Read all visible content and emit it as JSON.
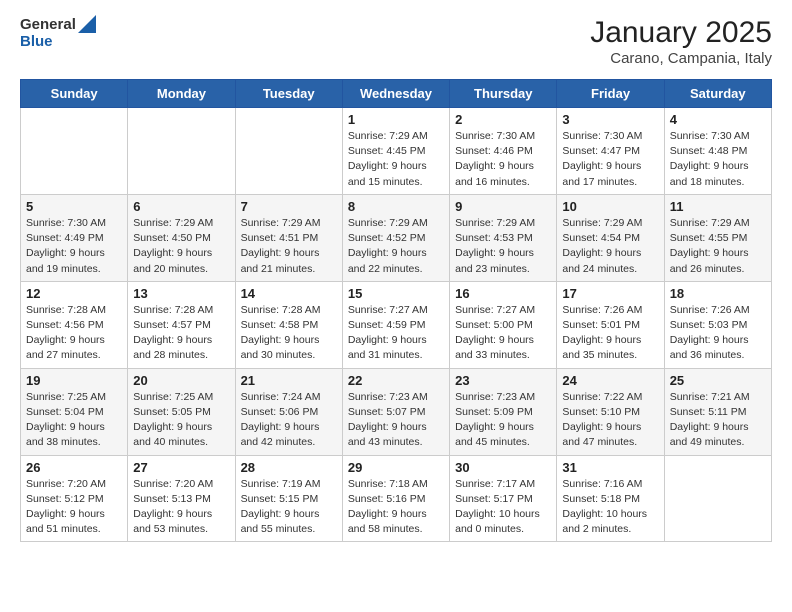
{
  "header": {
    "logo_general": "General",
    "logo_blue": "Blue",
    "title": "January 2025",
    "subtitle": "Carano, Campania, Italy"
  },
  "columns": [
    "Sunday",
    "Monday",
    "Tuesday",
    "Wednesday",
    "Thursday",
    "Friday",
    "Saturday"
  ],
  "weeks": [
    [
      {
        "day": "",
        "sunrise": "",
        "sunset": "",
        "daylight": ""
      },
      {
        "day": "",
        "sunrise": "",
        "sunset": "",
        "daylight": ""
      },
      {
        "day": "",
        "sunrise": "",
        "sunset": "",
        "daylight": ""
      },
      {
        "day": "1",
        "sunrise": "Sunrise: 7:29 AM",
        "sunset": "Sunset: 4:45 PM",
        "daylight": "Daylight: 9 hours and 15 minutes."
      },
      {
        "day": "2",
        "sunrise": "Sunrise: 7:30 AM",
        "sunset": "Sunset: 4:46 PM",
        "daylight": "Daylight: 9 hours and 16 minutes."
      },
      {
        "day": "3",
        "sunrise": "Sunrise: 7:30 AM",
        "sunset": "Sunset: 4:47 PM",
        "daylight": "Daylight: 9 hours and 17 minutes."
      },
      {
        "day": "4",
        "sunrise": "Sunrise: 7:30 AM",
        "sunset": "Sunset: 4:48 PM",
        "daylight": "Daylight: 9 hours and 18 minutes."
      }
    ],
    [
      {
        "day": "5",
        "sunrise": "Sunrise: 7:30 AM",
        "sunset": "Sunset: 4:49 PM",
        "daylight": "Daylight: 9 hours and 19 minutes."
      },
      {
        "day": "6",
        "sunrise": "Sunrise: 7:29 AM",
        "sunset": "Sunset: 4:50 PM",
        "daylight": "Daylight: 9 hours and 20 minutes."
      },
      {
        "day": "7",
        "sunrise": "Sunrise: 7:29 AM",
        "sunset": "Sunset: 4:51 PM",
        "daylight": "Daylight: 9 hours and 21 minutes."
      },
      {
        "day": "8",
        "sunrise": "Sunrise: 7:29 AM",
        "sunset": "Sunset: 4:52 PM",
        "daylight": "Daylight: 9 hours and 22 minutes."
      },
      {
        "day": "9",
        "sunrise": "Sunrise: 7:29 AM",
        "sunset": "Sunset: 4:53 PM",
        "daylight": "Daylight: 9 hours and 23 minutes."
      },
      {
        "day": "10",
        "sunrise": "Sunrise: 7:29 AM",
        "sunset": "Sunset: 4:54 PM",
        "daylight": "Daylight: 9 hours and 24 minutes."
      },
      {
        "day": "11",
        "sunrise": "Sunrise: 7:29 AM",
        "sunset": "Sunset: 4:55 PM",
        "daylight": "Daylight: 9 hours and 26 minutes."
      }
    ],
    [
      {
        "day": "12",
        "sunrise": "Sunrise: 7:28 AM",
        "sunset": "Sunset: 4:56 PM",
        "daylight": "Daylight: 9 hours and 27 minutes."
      },
      {
        "day": "13",
        "sunrise": "Sunrise: 7:28 AM",
        "sunset": "Sunset: 4:57 PM",
        "daylight": "Daylight: 9 hours and 28 minutes."
      },
      {
        "day": "14",
        "sunrise": "Sunrise: 7:28 AM",
        "sunset": "Sunset: 4:58 PM",
        "daylight": "Daylight: 9 hours and 30 minutes."
      },
      {
        "day": "15",
        "sunrise": "Sunrise: 7:27 AM",
        "sunset": "Sunset: 4:59 PM",
        "daylight": "Daylight: 9 hours and 31 minutes."
      },
      {
        "day": "16",
        "sunrise": "Sunrise: 7:27 AM",
        "sunset": "Sunset: 5:00 PM",
        "daylight": "Daylight: 9 hours and 33 minutes."
      },
      {
        "day": "17",
        "sunrise": "Sunrise: 7:26 AM",
        "sunset": "Sunset: 5:01 PM",
        "daylight": "Daylight: 9 hours and 35 minutes."
      },
      {
        "day": "18",
        "sunrise": "Sunrise: 7:26 AM",
        "sunset": "Sunset: 5:03 PM",
        "daylight": "Daylight: 9 hours and 36 minutes."
      }
    ],
    [
      {
        "day": "19",
        "sunrise": "Sunrise: 7:25 AM",
        "sunset": "Sunset: 5:04 PM",
        "daylight": "Daylight: 9 hours and 38 minutes."
      },
      {
        "day": "20",
        "sunrise": "Sunrise: 7:25 AM",
        "sunset": "Sunset: 5:05 PM",
        "daylight": "Daylight: 9 hours and 40 minutes."
      },
      {
        "day": "21",
        "sunrise": "Sunrise: 7:24 AM",
        "sunset": "Sunset: 5:06 PM",
        "daylight": "Daylight: 9 hours and 42 minutes."
      },
      {
        "day": "22",
        "sunrise": "Sunrise: 7:23 AM",
        "sunset": "Sunset: 5:07 PM",
        "daylight": "Daylight: 9 hours and 43 minutes."
      },
      {
        "day": "23",
        "sunrise": "Sunrise: 7:23 AM",
        "sunset": "Sunset: 5:09 PM",
        "daylight": "Daylight: 9 hours and 45 minutes."
      },
      {
        "day": "24",
        "sunrise": "Sunrise: 7:22 AM",
        "sunset": "Sunset: 5:10 PM",
        "daylight": "Daylight: 9 hours and 47 minutes."
      },
      {
        "day": "25",
        "sunrise": "Sunrise: 7:21 AM",
        "sunset": "Sunset: 5:11 PM",
        "daylight": "Daylight: 9 hours and 49 minutes."
      }
    ],
    [
      {
        "day": "26",
        "sunrise": "Sunrise: 7:20 AM",
        "sunset": "Sunset: 5:12 PM",
        "daylight": "Daylight: 9 hours and 51 minutes."
      },
      {
        "day": "27",
        "sunrise": "Sunrise: 7:20 AM",
        "sunset": "Sunset: 5:13 PM",
        "daylight": "Daylight: 9 hours and 53 minutes."
      },
      {
        "day": "28",
        "sunrise": "Sunrise: 7:19 AM",
        "sunset": "Sunset: 5:15 PM",
        "daylight": "Daylight: 9 hours and 55 minutes."
      },
      {
        "day": "29",
        "sunrise": "Sunrise: 7:18 AM",
        "sunset": "Sunset: 5:16 PM",
        "daylight": "Daylight: 9 hours and 58 minutes."
      },
      {
        "day": "30",
        "sunrise": "Sunrise: 7:17 AM",
        "sunset": "Sunset: 5:17 PM",
        "daylight": "Daylight: 10 hours and 0 minutes."
      },
      {
        "day": "31",
        "sunrise": "Sunrise: 7:16 AM",
        "sunset": "Sunset: 5:18 PM",
        "daylight": "Daylight: 10 hours and 2 minutes."
      },
      {
        "day": "",
        "sunrise": "",
        "sunset": "",
        "daylight": ""
      }
    ]
  ]
}
